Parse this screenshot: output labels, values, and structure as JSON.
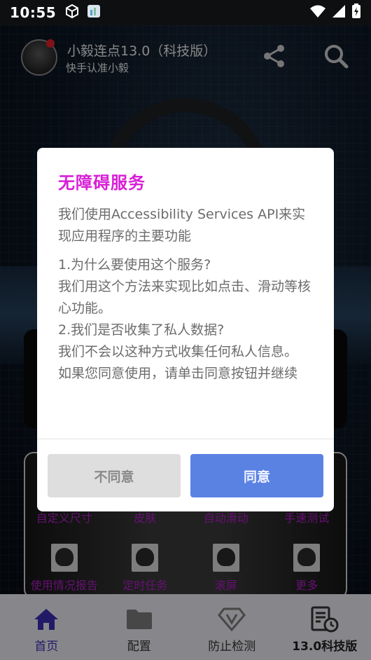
{
  "status_bar": {
    "time": "10:55"
  },
  "header": {
    "title": "小毅连点13.0（科技版）",
    "subtitle": "快手认准小毅"
  },
  "dialog": {
    "title": "无障碍服务",
    "body": [
      "我们使用Accessibility Services API来实现应用程序的主要功能",
      "1.为什么要使用这个服务?",
      "我们用这个方法来实现比如点击、滑动等核心功能。",
      "2.我们是否收集了私人数据?",
      "我们不会以这种方式收集任何私人信息。",
      "如果您同意使用，请单击同意按钮并继续"
    ],
    "disagree_label": "不同意",
    "agree_label": "同意"
  },
  "grid": {
    "row1": [
      "自定义尺寸",
      "皮肤",
      "自动滑动",
      "手速测试"
    ],
    "row2": [
      "使用情况报告",
      "定时任务",
      "滚屏",
      "更多"
    ]
  },
  "bottom_nav": {
    "items": [
      {
        "label": "首页",
        "icon": "home-icon"
      },
      {
        "label": "配置",
        "icon": "folder-icon"
      },
      {
        "label": "防止检测",
        "icon": "shield-v-icon"
      },
      {
        "label": "13.0科技版",
        "icon": "document-clock-icon"
      }
    ]
  },
  "colors": {
    "dialog_title": "#d81fd6",
    "agree_button": "#5a82e3",
    "disagree_button": "#dedede",
    "nav_active": "#3b2db0",
    "grid_label": "#b01ec7"
  }
}
